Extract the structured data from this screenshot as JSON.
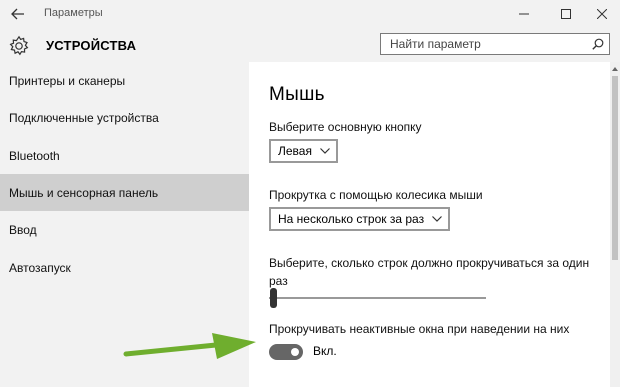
{
  "window": {
    "title": "Параметры",
    "icons": {
      "back": "back-arrow-icon",
      "minimize": "minimize-icon",
      "maximize": "maximize-icon",
      "close": "close-icon"
    }
  },
  "header": {
    "section_title": "УСТРОЙСТВА",
    "icon": "gear-icon",
    "search": {
      "placeholder": "Найти параметр",
      "value": "",
      "icon": "search-icon"
    }
  },
  "sidebar": {
    "items": [
      {
        "label": "Принтеры и сканеры",
        "selected": false
      },
      {
        "label": "Подключенные устройства",
        "selected": false
      },
      {
        "label": "Bluetooth",
        "selected": false
      },
      {
        "label": "Мышь и сенсорная панель",
        "selected": true
      },
      {
        "label": "Ввод",
        "selected": false
      },
      {
        "label": "Автозапуск",
        "selected": false
      }
    ]
  },
  "main": {
    "title": "Мышь",
    "primary_button": {
      "label": "Выберите основную кнопку",
      "value": "Левая"
    },
    "wheel_scroll": {
      "label": "Прокрутка с помощью колесика мыши",
      "value": "На несколько строк за раз"
    },
    "lines_slider": {
      "label": "Выберите, сколько строк должно прокручиваться за один раз",
      "level": 0.03
    },
    "inactive_scroll": {
      "label": "Прокручивать неактивные окна при наведении на них",
      "state": "Вкл.",
      "on": true
    }
  },
  "colors": {
    "chrome_bg": "#f2f2f2",
    "selected_item_bg": "#cfcfcf",
    "toggle_on": "#666666",
    "annotation_arrow": "#6fae2e"
  }
}
